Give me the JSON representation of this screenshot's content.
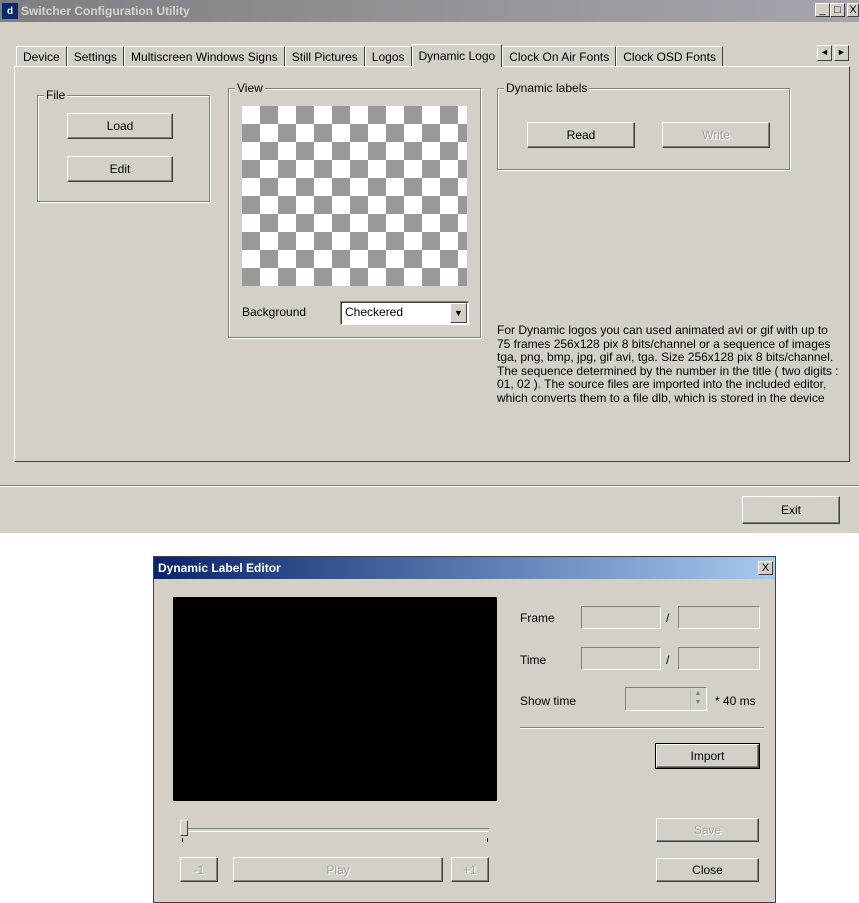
{
  "main_window": {
    "title": "Switcher Configuration Utility",
    "icon": "ds-app-icon",
    "min": "_",
    "max": "□",
    "close": "X",
    "tabs": [
      "Device",
      "Settings",
      "Multiscreen Windows Signs",
      "Still Pictures",
      "Logos",
      "Dynamic Logo",
      "Clock On Air Fonts",
      "Clock OSD Fonts"
    ],
    "active_tab": "Dynamic Logo",
    "tab_scroll_left": "◄",
    "tab_scroll_right": "►",
    "file_group": {
      "label": "File",
      "load": "Load",
      "edit": "Edit"
    },
    "view_group": {
      "label": "View",
      "background_label": "Background",
      "background_value": "Checkered",
      "dropdown_arrow": "▼"
    },
    "dynamic_labels_group": {
      "label": "Dynamic labels",
      "read": "Read",
      "write": "Write"
    },
    "description": "For Dynamic logos you can used  animated  avi or gif with up to 75 frames  256x128 pix 8 bits/channel  or a sequence of  images tga, png, bmp, jpg, gif avi, tga. Size 256x128 pix 8 bits/channel. The sequence determined by the number in the title ( two digits  : 01, 02 ). The source files are imported into the included editor, which converts them to a file dlb, which is stored in the device",
    "exit": "Exit"
  },
  "editor_window": {
    "title": "Dynamic Label Editor",
    "close": "X",
    "frame_label": "Frame",
    "time_label": "Time",
    "separator": "/",
    "show_time_label": "Show time",
    "show_time_unit": "* 40 ms",
    "import": "Import",
    "save": "Save",
    "close_button": "Close",
    "prev": "-1",
    "play": "Play",
    "next": "+1"
  }
}
